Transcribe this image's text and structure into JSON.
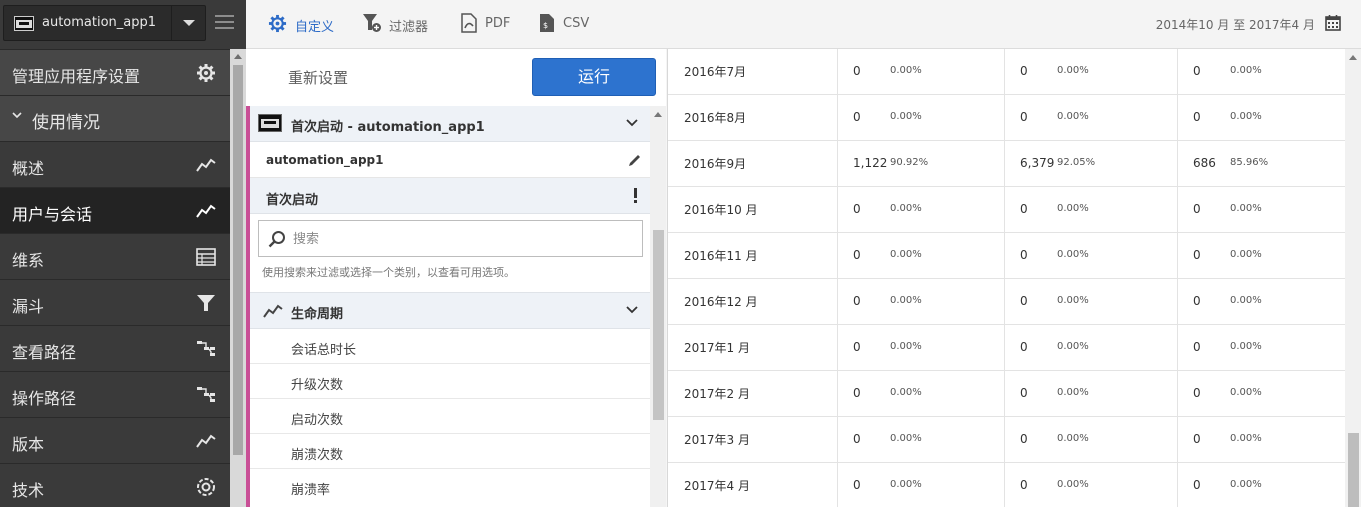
{
  "app_selector": {
    "name": "automation_app1"
  },
  "sidebar": {
    "items": [
      {
        "label": "管理应用程序设置",
        "icon": "gear-icon"
      },
      {
        "label": "使用情况",
        "icon": "chevron-down-icon"
      },
      {
        "label": "概述",
        "icon": "trend-icon"
      },
      {
        "label": "用户与会话",
        "icon": "trend-icon"
      },
      {
        "label": "维系",
        "icon": "table-icon"
      },
      {
        "label": "漏斗",
        "icon": "funnel-icon"
      },
      {
        "label": "查看路径",
        "icon": "path-icon"
      },
      {
        "label": "操作路径",
        "icon": "path-icon"
      },
      {
        "label": "版本",
        "icon": "trend-icon"
      },
      {
        "label": "技术",
        "icon": "gauge-icon"
      }
    ],
    "active_index": 3
  },
  "toolbar": {
    "customize_label": "自定义",
    "filter_label": "过滤器",
    "pdf_label": "PDF",
    "csv_label": "CSV",
    "date_range": "2014年10 月 至 2017年4 月",
    "accent_color": "#2d6bc7"
  },
  "panel": {
    "reset_label": "重新设置",
    "run_label": "运行",
    "report_title": "首次启动 - automation_app1",
    "report_suite": "automation_app1",
    "metric_label": "首次启动",
    "search_placeholder": "搜索",
    "search_hint": "使用搜索来过滤或选择一个类别，以查看可用选项。",
    "category_label": "生命周期",
    "category_items": [
      "会话总时长",
      "升级次数",
      "启动次数",
      "崩溃次数",
      "崩溃率"
    ]
  },
  "table": {
    "rows": [
      {
        "month": "2016年7月",
        "cols": [
          {
            "v": "0",
            "p": "0.00%"
          },
          {
            "v": "0",
            "p": "0.00%"
          },
          {
            "v": "0",
            "p": "0.00%"
          }
        ]
      },
      {
        "month": "2016年8月",
        "cols": [
          {
            "v": "0",
            "p": "0.00%"
          },
          {
            "v": "0",
            "p": "0.00%"
          },
          {
            "v": "0",
            "p": "0.00%"
          }
        ]
      },
      {
        "month": "2016年9月",
        "cols": [
          {
            "v": "1,122",
            "p": "90.92%"
          },
          {
            "v": "6,379",
            "p": "92.05%"
          },
          {
            "v": "686",
            "p": "85.96%"
          }
        ]
      },
      {
        "month": "2016年10 月",
        "cols": [
          {
            "v": "0",
            "p": "0.00%"
          },
          {
            "v": "0",
            "p": "0.00%"
          },
          {
            "v": "0",
            "p": "0.00%"
          }
        ]
      },
      {
        "month": "2016年11 月",
        "cols": [
          {
            "v": "0",
            "p": "0.00%"
          },
          {
            "v": "0",
            "p": "0.00%"
          },
          {
            "v": "0",
            "p": "0.00%"
          }
        ]
      },
      {
        "month": "2016年12 月",
        "cols": [
          {
            "v": "0",
            "p": "0.00%"
          },
          {
            "v": "0",
            "p": "0.00%"
          },
          {
            "v": "0",
            "p": "0.00%"
          }
        ]
      },
      {
        "month": "2017年1 月",
        "cols": [
          {
            "v": "0",
            "p": "0.00%"
          },
          {
            "v": "0",
            "p": "0.00%"
          },
          {
            "v": "0",
            "p": "0.00%"
          }
        ]
      },
      {
        "month": "2017年2 月",
        "cols": [
          {
            "v": "0",
            "p": "0.00%"
          },
          {
            "v": "0",
            "p": "0.00%"
          },
          {
            "v": "0",
            "p": "0.00%"
          }
        ]
      },
      {
        "month": "2017年3 月",
        "cols": [
          {
            "v": "0",
            "p": "0.00%"
          },
          {
            "v": "0",
            "p": "0.00%"
          },
          {
            "v": "0",
            "p": "0.00%"
          }
        ]
      },
      {
        "month": "2017年4 月",
        "cols": [
          {
            "v": "0",
            "p": "0.00%"
          },
          {
            "v": "0",
            "p": "0.00%"
          },
          {
            "v": "0",
            "p": "0.00%"
          }
        ]
      }
    ]
  }
}
